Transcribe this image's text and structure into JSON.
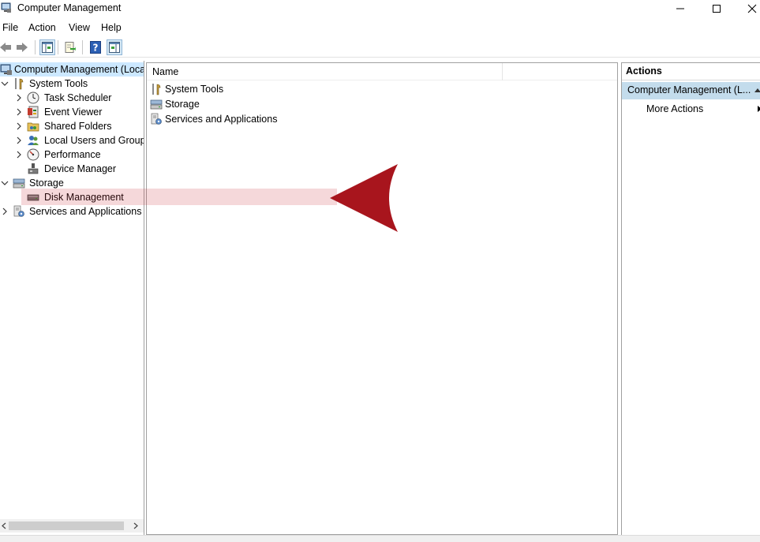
{
  "window": {
    "title": "Computer Management",
    "controls": {
      "minimize": "minimize",
      "maximize": "maximize",
      "close": "close"
    }
  },
  "menu": {
    "file": "File",
    "action": "Action",
    "view": "View",
    "help": "Help"
  },
  "tree": {
    "root": "Computer Management (Local",
    "system_tools": "System Tools",
    "task_scheduler": "Task Scheduler",
    "event_viewer": "Event Viewer",
    "shared_folders": "Shared Folders",
    "local_users": "Local Users and Groups",
    "performance": "Performance",
    "device_manager": "Device Manager",
    "storage": "Storage",
    "disk_management": "Disk Management",
    "services_apps": "Services and Applications"
  },
  "center": {
    "column_name": "Name",
    "items": [
      "System Tools",
      "Storage",
      "Services and Applications"
    ]
  },
  "actions": {
    "header": "Actions",
    "section": "Computer Management (L...",
    "more_actions": "More Actions"
  },
  "colors": {
    "selection": "#cce8ff",
    "actions_section": "#c3dcec",
    "annotation": "#a8151d"
  }
}
